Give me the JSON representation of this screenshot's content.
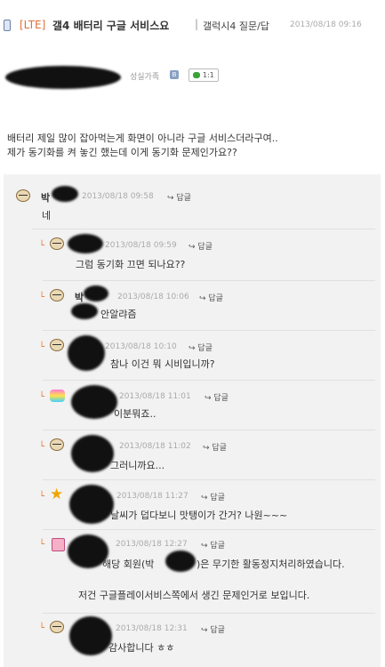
{
  "post": {
    "tag": "[LTE]",
    "title": "갤4 배터리 구글 서비스요",
    "separator": "|",
    "board": "갤럭시4 질문/답",
    "date": "2013/08/18 09:16",
    "author_class": "성실가족",
    "comment_badge": "1:1",
    "body": [
      "배터리 제일 많이 잡아먹는게 화면이 아니라 구글 서비스더라구여..",
      "제가 동기화를 켜 놓긴 했는데 이게 동기화 문제인가요??"
    ]
  },
  "comments": [
    {
      "name_part": "박",
      "date": "2013/08/18 09:58",
      "reply_label": "답글",
      "text": [
        "네"
      ],
      "avatar": "face-icon"
    },
    {
      "name_part": "",
      "date": "2013/08/18 09:59",
      "reply_label": "답글",
      "text": [
        "그럼 동기화 끄면 되나요??"
      ],
      "avatar": "face-icon"
    },
    {
      "name_part": "박",
      "date": "2013/08/18 10:06",
      "reply_label": "답글",
      "text": [
        "안알랴즘"
      ],
      "avatar": "face-icon"
    },
    {
      "name_part": "",
      "date": "2013/08/18 10:10",
      "reply_label": "답글",
      "text": [
        "참나 이건 뭐 시비입니까?"
      ],
      "avatar": "face-icon"
    },
    {
      "name_part": "",
      "date": "2013/08/18 11:01",
      "reply_label": "답글",
      "text": [
        "이분뭐죠.."
      ],
      "avatar": "heart-icon"
    },
    {
      "name_part": "",
      "date": "2013/08/18 11:02",
      "reply_label": "답글",
      "text": [
        "그러니까요..."
      ],
      "avatar": "face-icon"
    },
    {
      "name_part": "",
      "date": "2013/08/18 11:27",
      "reply_label": "답글",
      "text": [
        "날씨가 덥다보니 맛탱이가 간거? 나원~~~"
      ],
      "avatar": "star-icon"
    },
    {
      "name_part": "",
      "date": "2013/08/18 12:27",
      "reply_label": "답글",
      "text": [
        "해당 회원(박",
        ")은 무기한 활동정지처리하였습니다.",
        "저건 구글플레이서비스쪽에서 생긴 문제인거로 보입니다."
      ],
      "avatar": "doll-icon"
    },
    {
      "name_part": "",
      "date": "2013/08/18 12:31",
      "reply_label": "답글",
      "text": [
        "감사합니다 ㅎㅎ"
      ],
      "avatar": "face-icon"
    }
  ]
}
